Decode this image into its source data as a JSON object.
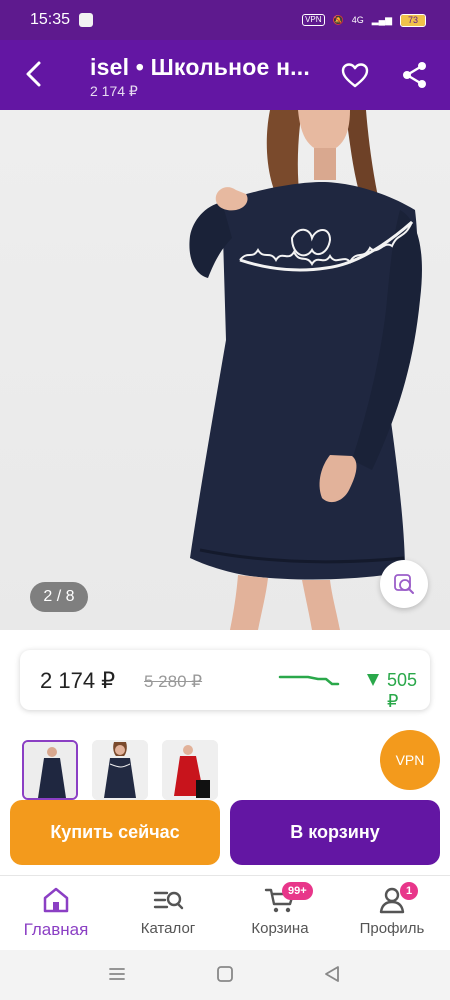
{
  "status_bar": {
    "time": "15:35",
    "vpn": "VPN",
    "network": "4G",
    "battery": "73"
  },
  "header": {
    "title": "isel • Школьное н...",
    "price": "2 174 ₽"
  },
  "gallery": {
    "counter": "2 / 8"
  },
  "price_card": {
    "current": "2 174 ₽",
    "old": "5 280 ₽",
    "drop": "505 ₽"
  },
  "floating": {
    "vpn_label": "VPN"
  },
  "actions": {
    "buy_now": "Купить сейчас",
    "add_to_cart": "В корзину"
  },
  "bottom_nav": {
    "items": [
      {
        "label": "Главная",
        "icon": "home-icon",
        "active": true
      },
      {
        "label": "Каталог",
        "icon": "catalog-search-icon"
      },
      {
        "label": "Корзина",
        "icon": "cart-icon",
        "badge": "99+"
      },
      {
        "label": "Профиль",
        "icon": "profile-icon",
        "badge": "1"
      }
    ]
  },
  "colors": {
    "brand_purple": "#6316a3",
    "accent_orange": "#f39a1c",
    "price_drop_green": "#2aa84a",
    "badge_pink": "#e8368a"
  }
}
